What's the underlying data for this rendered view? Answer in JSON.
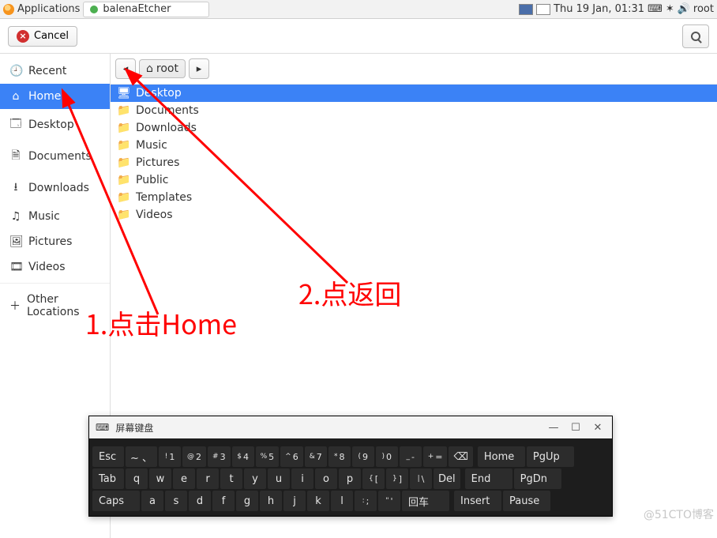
{
  "topbar": {
    "applications": "Applications",
    "task": "balenaEtcher",
    "clock": "Thu 19 Jan, 01:31",
    "user": "root"
  },
  "toolbar": {
    "cancel": "Cancel"
  },
  "sidebar": {
    "recent": "Recent",
    "home": "Home",
    "desktop": "Desktop",
    "documents": "Documents",
    "downloads": "Downloads",
    "music": "Music",
    "pictures": "Pictures",
    "videos": "Videos",
    "other": "Other Locations"
  },
  "breadcrumb": {
    "root": "root"
  },
  "files": {
    "desktop": "Desktop",
    "documents": "Documents",
    "downloads": "Downloads",
    "music": "Music",
    "pictures": "Pictures",
    "public": "Public",
    "templates": "Templates",
    "videos": "Videos"
  },
  "annotations": {
    "one": "1.点击Home",
    "two": "2.点返回"
  },
  "osk": {
    "title": "屏幕键盘",
    "row1_left": [
      "Esc",
      "~ 、"
    ],
    "row1_nums": [
      [
        "!",
        "1"
      ],
      [
        "@",
        "2"
      ],
      [
        "#",
        "3"
      ],
      [
        "$",
        "4"
      ],
      [
        "%",
        "5"
      ],
      [
        "^",
        "6"
      ],
      [
        "&",
        "7"
      ],
      [
        "*",
        "8"
      ],
      [
        "(",
        "9"
      ],
      [
        ")",
        "0"
      ],
      [
        "_",
        "-"
      ],
      [
        "+",
        "="
      ]
    ],
    "row1_bksp": "⌫",
    "row2_left": "Tab",
    "row2_keys": [
      "q",
      "w",
      "e",
      "r",
      "t",
      "y",
      "u",
      "i",
      "o",
      "p"
    ],
    "row2_br": [
      [
        "{",
        "["
      ],
      [
        "}",
        "]"
      ],
      [
        "|",
        "\\"
      ]
    ],
    "row2_del": "Del",
    "row3_left": "Caps",
    "row3_keys": [
      "a",
      "s",
      "d",
      "f",
      "g",
      "h",
      "j",
      "k",
      "l"
    ],
    "row3_punct": [
      [
        ":",
        ";"
      ],
      [
        "\"",
        "'"
      ]
    ],
    "row3_enter": "回车",
    "nav": {
      "home": "Home",
      "pgup": "PgUp",
      "end": "End",
      "pgdn": "PgDn",
      "insert": "Insert",
      "pause": "Pause"
    }
  },
  "watermark": "@51CTO博客"
}
